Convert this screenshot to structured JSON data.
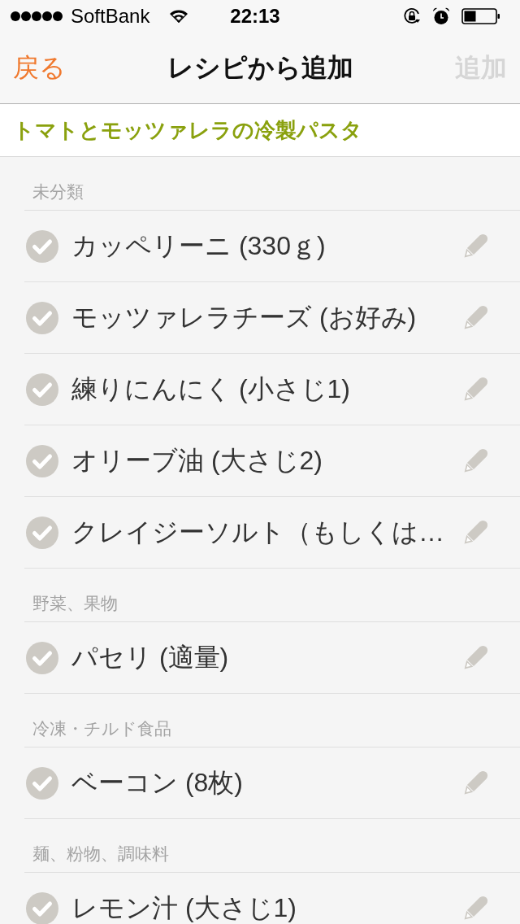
{
  "status_bar": {
    "carrier": "SoftBank",
    "time": "22:13"
  },
  "nav_bar": {
    "back": "戻る",
    "title": "レシピから追加",
    "add": {
      "label": "追加",
      "disabled": true
    }
  },
  "recipe_title": "トマトとモッツァレラの冷製パスタ",
  "sections": [
    {
      "title": "未分類",
      "items": [
        {
          "name": "カッペリーニ (330ｇ)",
          "checked": false
        },
        {
          "name": "モッツァレラチーズ (お好み)",
          "checked": false
        },
        {
          "name": "練りにんにく (小さじ1)",
          "checked": false
        },
        {
          "name": "オリーブ油 (大さじ2)",
          "checked": false
        },
        {
          "name": "クレイジーソルト（もしくは…",
          "checked": false
        }
      ]
    },
    {
      "title": "野菜、果物",
      "items": [
        {
          "name": "パセリ (適量)",
          "checked": false
        }
      ]
    },
    {
      "title": "冷凍・チルド食品",
      "items": [
        {
          "name": "ベーコン (8枚)",
          "checked": false
        }
      ]
    },
    {
      "title": "麺、粉物、調味料",
      "items": [
        {
          "name": "レモン汁 (大さじ1)",
          "checked": false
        }
      ]
    }
  ]
}
